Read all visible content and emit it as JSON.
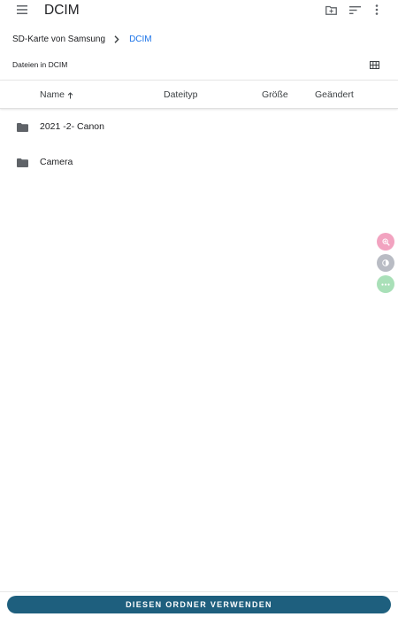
{
  "appbar": {
    "title": "DCIM",
    "icons": [
      "menu-icon",
      "new-folder-icon",
      "sort-icon",
      "more-vert-icon"
    ]
  },
  "breadcrumb": {
    "root": "SD-Karte von Samsung",
    "current": "DCIM"
  },
  "subheader": {
    "label": "Dateien in DCIM",
    "view_toggle_icon": "grid-view-icon"
  },
  "columns": {
    "name": "Name",
    "type": "Dateityp",
    "size": "Größe",
    "modified": "Geändert"
  },
  "rows": [
    {
      "name": "2021 -2- Canon",
      "icon": "folder-icon"
    },
    {
      "name": "Camera",
      "icon": "folder-icon"
    }
  ],
  "floating_tools": [
    "zoom-in-icon",
    "contrast-icon",
    "more-horiz-icon"
  ],
  "action_button": {
    "label": "DIESEN ORDNER VERWENDEN"
  },
  "colors": {
    "accent": "#1a73e8",
    "button": "#1e5f7e",
    "icon": "#5f6368"
  }
}
